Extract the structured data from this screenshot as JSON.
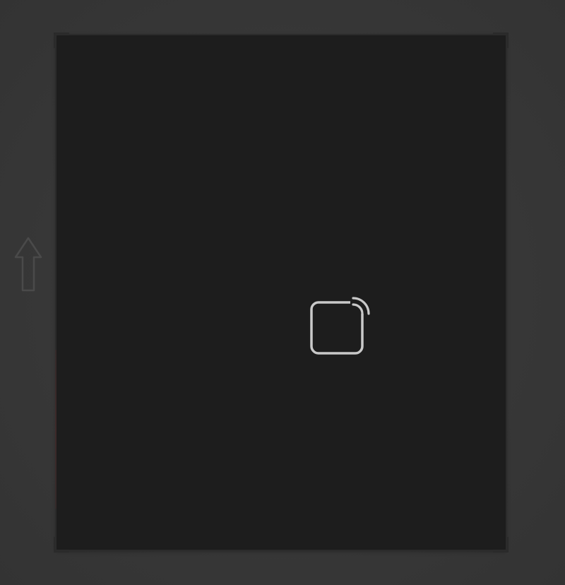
{
  "screen": {
    "background_color": "#3a3a3a",
    "frame_color": "#1d1d1d"
  },
  "icons": {
    "side_arrow": "up-arrow-icon",
    "center": "cast-to-device-icon",
    "center_color": "#c9c9c9"
  }
}
